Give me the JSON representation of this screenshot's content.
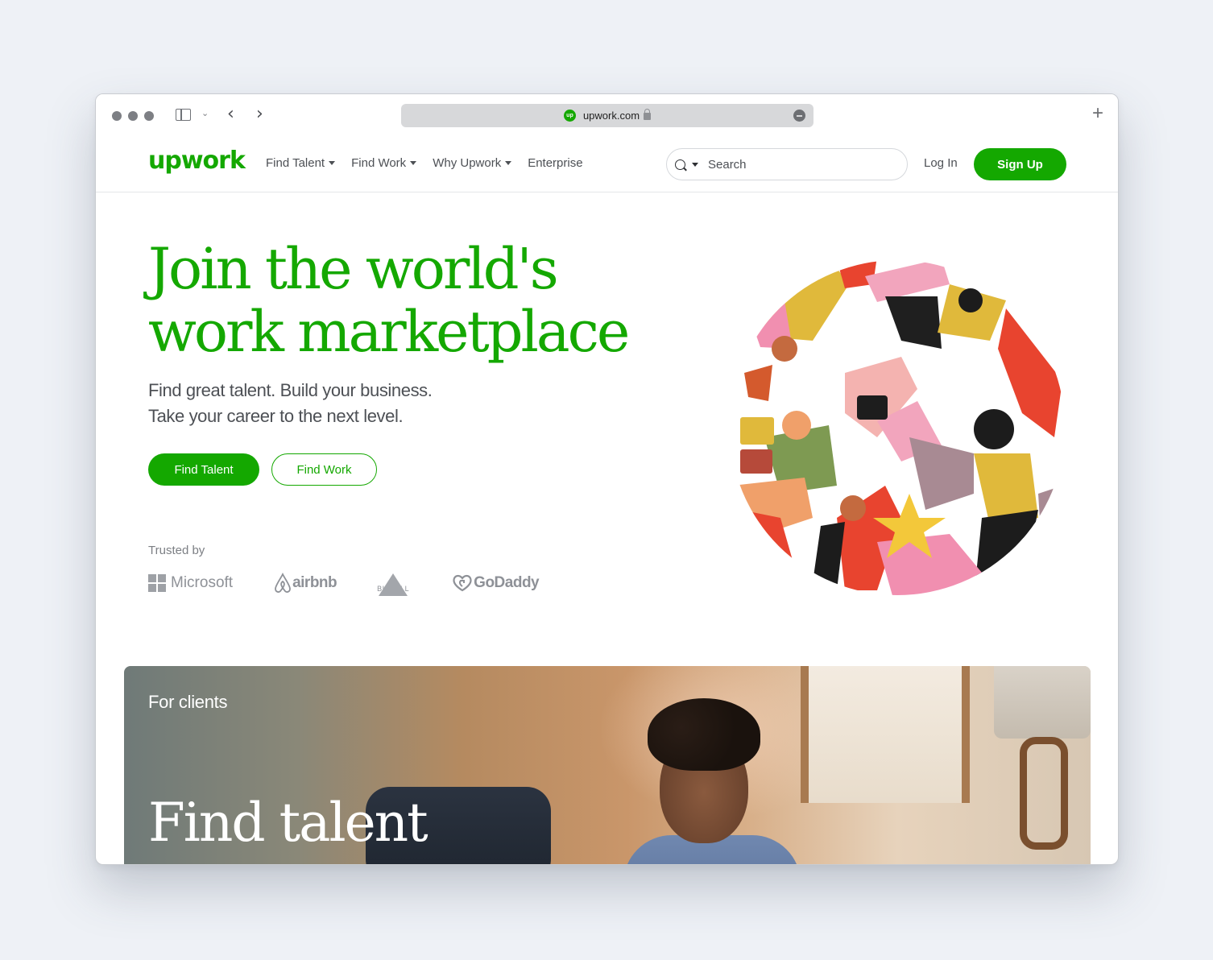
{
  "browser": {
    "url": "upwork.com",
    "new_tab_icon": "plus-icon",
    "reader_icon": "reader-icon"
  },
  "header": {
    "logo": "upwork",
    "nav": [
      {
        "label": "Find Talent",
        "has_dropdown": true
      },
      {
        "label": "Find Work",
        "has_dropdown": true
      },
      {
        "label": "Why Upwork",
        "has_dropdown": true
      },
      {
        "label": "Enterprise",
        "has_dropdown": false
      }
    ],
    "search_placeholder": "Search",
    "login_label": "Log In",
    "signup_label": "Sign Up"
  },
  "hero": {
    "title_line1": "Join the world's",
    "title_line2": "work marketplace",
    "subtitle_line1": "Find great talent. Build your business.",
    "subtitle_line2": "Take your career to the next level.",
    "primary_button": "Find Talent",
    "secondary_button": "Find Work"
  },
  "trusted": {
    "label": "Trusted by",
    "brands": [
      "Microsoft",
      "airbnb",
      "BISSELL",
      "GoDaddy"
    ]
  },
  "clients_card": {
    "eyebrow": "For clients",
    "title": "Find talent"
  },
  "colors": {
    "brand_green": "#14a800",
    "text_gray": "#4d5055",
    "page_bg": "#eef1f6"
  }
}
